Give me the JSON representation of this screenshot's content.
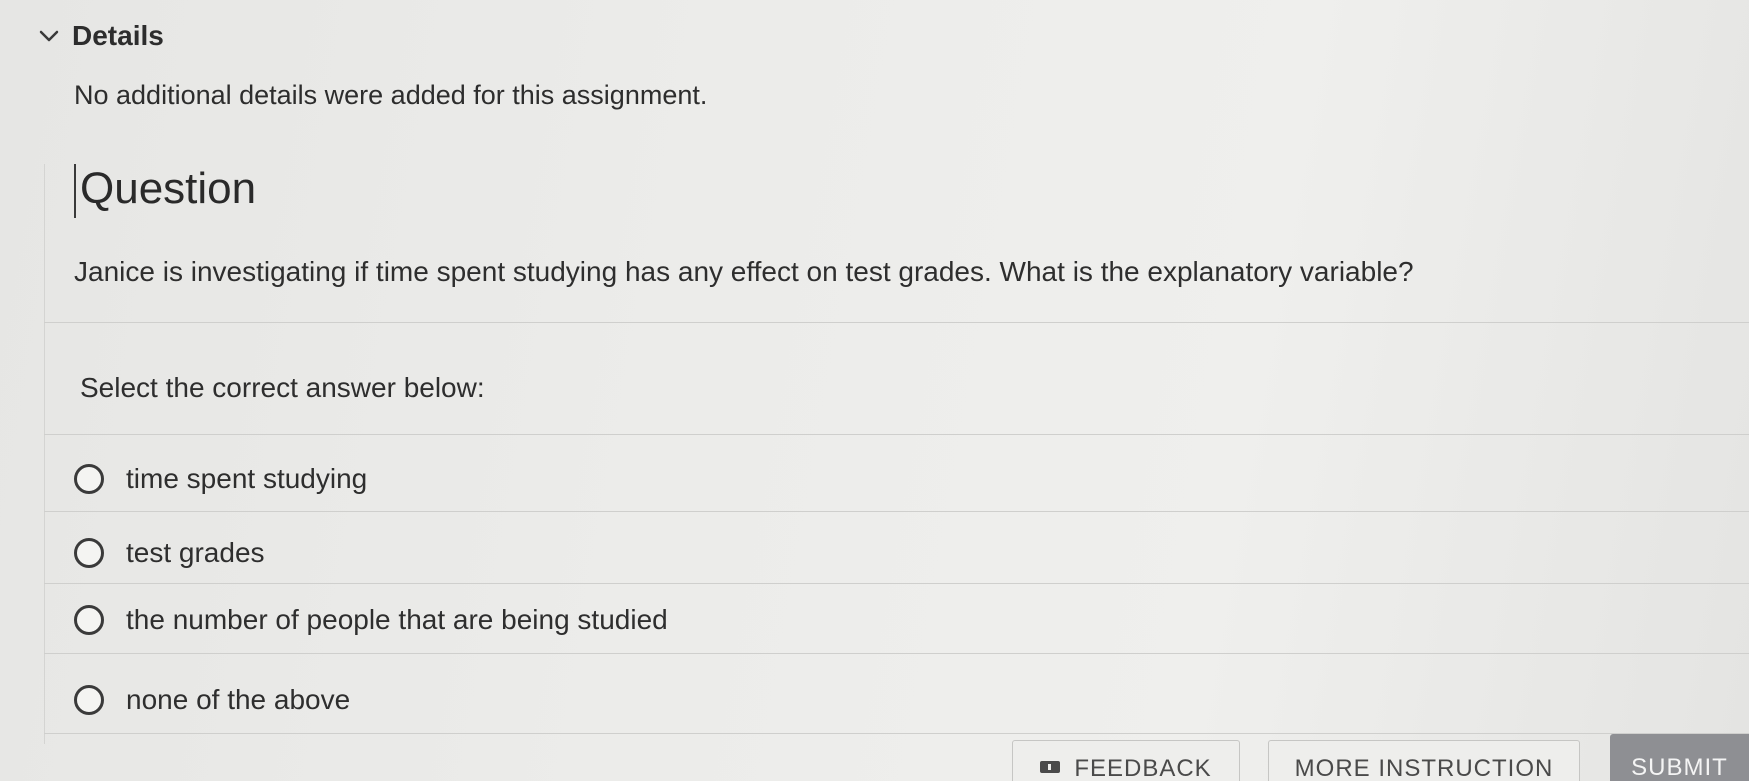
{
  "details": {
    "title": "Details",
    "text": "No additional details were added for this assignment."
  },
  "question": {
    "heading": "Question",
    "prompt": "Janice is investigating if time spent studying has any effect on test grades. What is the explanatory variable?",
    "instruction": "Select the correct answer below:",
    "options": [
      {
        "label": "time spent studying"
      },
      {
        "label": "test grades"
      },
      {
        "label": "the number of people that are being studied"
      },
      {
        "label": "none of the above"
      }
    ]
  },
  "footer": {
    "feedback_label": "FEEDBACK",
    "more_instruction_label": "MORE INSTRUCTION",
    "submit_label": "SUBMIT"
  }
}
